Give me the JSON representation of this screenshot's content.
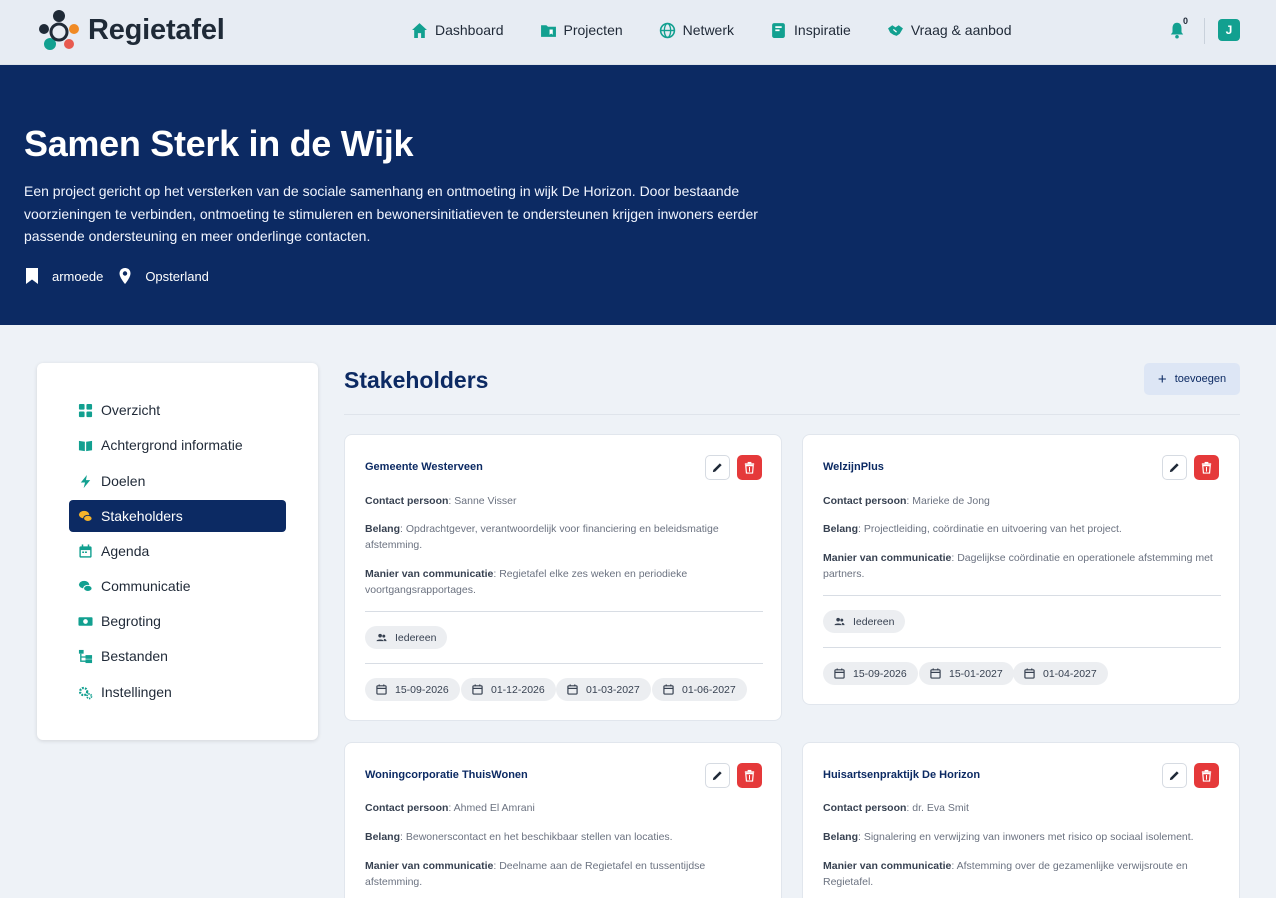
{
  "brand": {
    "name": "Regietafel"
  },
  "nav": [
    {
      "label": "Dashboard",
      "icon": "home-icon"
    },
    {
      "label": "Projecten",
      "icon": "folder-icon"
    },
    {
      "label": "Netwerk",
      "icon": "globe-icon"
    },
    {
      "label": "Inspiratie",
      "icon": "book-icon"
    },
    {
      "label": "Vraag & aanbod",
      "icon": "handshake-icon"
    }
  ],
  "notifications": {
    "count": "0"
  },
  "user": {
    "initial": "J"
  },
  "hero": {
    "title": "Samen Sterk in de Wijk",
    "description": "Een project gericht op het versterken van de sociale samenhang en ontmoeting in wijk De Horizon. Door bestaande voorzieningen te verbinden, ontmoeting te stimuleren en bewonersinitiatieven te ondersteunen krijgen inwoners eerder passende ondersteuning en meer onderlinge contacten.",
    "tag": "armoede",
    "location": "Opsterland"
  },
  "sidebar": {
    "items": [
      {
        "label": "Overzicht",
        "icon": "grid-icon"
      },
      {
        "label": "Achtergrond informatie",
        "icon": "open-book-icon"
      },
      {
        "label": "Doelen",
        "icon": "bolt-icon"
      },
      {
        "label": "Stakeholders",
        "icon": "chat-bubbles-icon",
        "active": true
      },
      {
        "label": "Agenda",
        "icon": "calendar-icon"
      },
      {
        "label": "Communicatie",
        "icon": "comments-icon"
      },
      {
        "label": "Begroting",
        "icon": "money-icon"
      },
      {
        "label": "Bestanden",
        "icon": "folder-tree-icon"
      },
      {
        "label": "Instellingen",
        "icon": "cogs-icon"
      }
    ]
  },
  "main": {
    "title": "Stakeholders",
    "add_label": "toevoegen"
  },
  "labels": {
    "contact": "Contact persoon",
    "belang": "Belang",
    "manier": "Manier van communicatie"
  },
  "cards": [
    {
      "name": "Gemeente Westerveen",
      "contact": ": Sanne Visser",
      "belang": ": Opdrachtgever, verantwoordelijk voor financiering en beleidsmatige afstemming.",
      "manier": ": Regietafel elke zes weken en periodieke voortgangsrapportages.",
      "audience": "Iedereen",
      "dates": [
        "15-09-2026",
        "01-12-2026",
        "01-03-2027",
        "01-06-2027"
      ]
    },
    {
      "name": "WelzijnPlus",
      "contact": ": Marieke de Jong",
      "belang": ": Projectleiding, coördinatie en uitvoering van het project.",
      "manier": ": Dagelijkse coördinatie en operationele afstemming met partners.",
      "audience": "Iedereen",
      "dates": [
        "15-09-2026",
        "15-01-2027",
        "01-04-2027"
      ]
    },
    {
      "name": "Woningcorporatie ThuisWonen",
      "contact": ": Ahmed El Amrani",
      "belang": ": Bewonerscontact en het beschikbaar stellen van locaties.",
      "manier": ": Deelname aan de Regietafel en tussentijdse afstemming."
    },
    {
      "name": "Huisartsenpraktijk De Horizon",
      "contact": ": dr. Eva Smit",
      "belang": ": Signalering en verwijzing van inwoners met risico op sociaal isolement.",
      "manier": ": Afstemming over de gezamenlijke verwijsroute en Regietafel."
    }
  ],
  "colors": {
    "navy": "#0c2a63",
    "teal": "#12a090",
    "danger": "#e5393a",
    "background": "#eef2f7"
  }
}
